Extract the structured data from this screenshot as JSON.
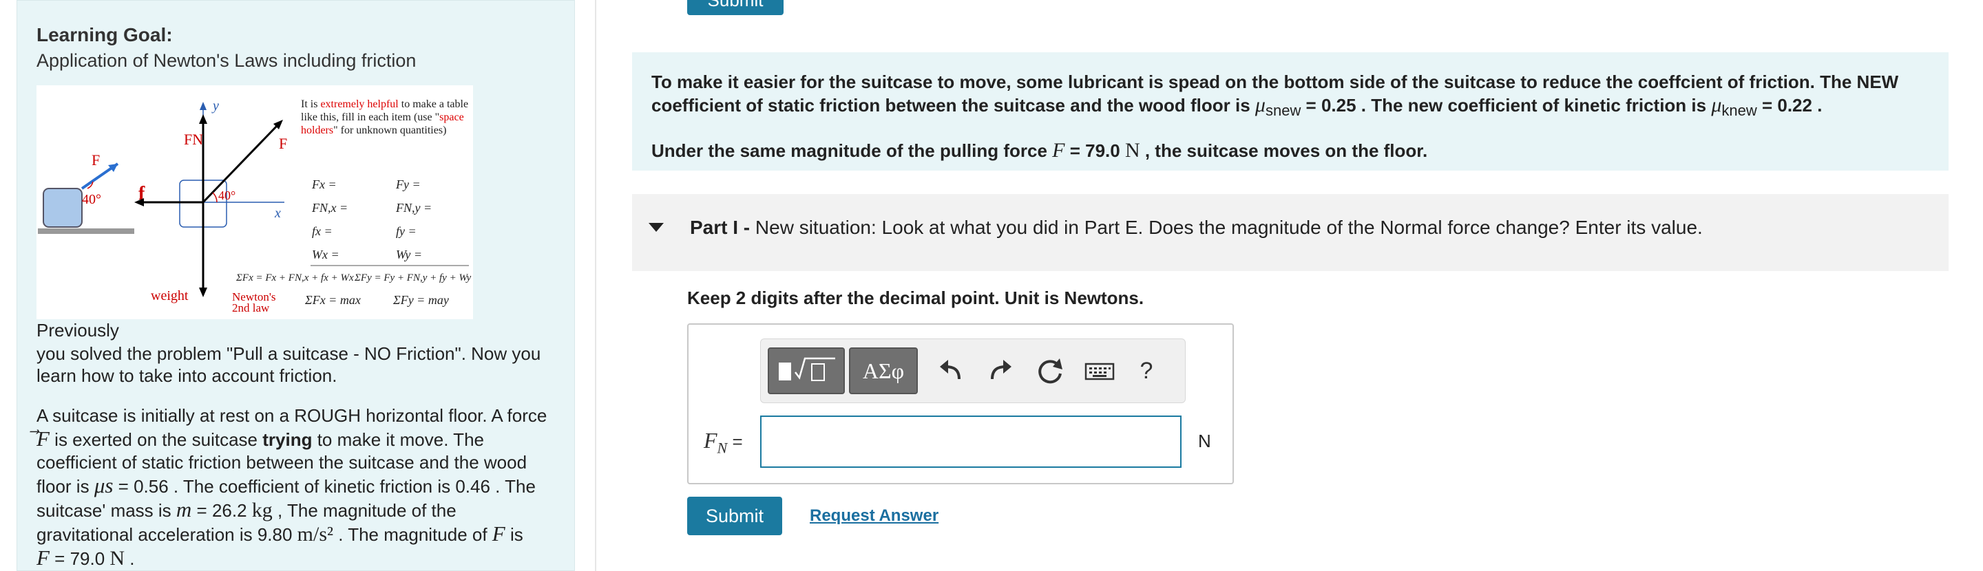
{
  "left": {
    "goal_title": "Learning Goal:",
    "goal_subtitle": "Application of Newton's Laws including friction",
    "figure": {
      "note_prefix": "It is ",
      "note_highlight": "extremely helpful",
      "note_mid": " to make a table like this, fill in each item (use \"",
      "note_highlight2": "space holders",
      "note_suffix": "\" for unknown quantities)",
      "label_F": "F",
      "label_FN": "FN",
      "label_f": "f",
      "label_angle": "40°",
      "label_weight": "weight",
      "label_x": "x",
      "label_y": "y",
      "newtons_law": "Newton's 2nd law",
      "table_left": [
        "Fx =",
        "FN,x =",
        "fx =",
        "Wx ="
      ],
      "table_right": [
        "Fy =",
        "FN,y =",
        "fy =",
        "Wy ="
      ],
      "sum_x": "ΣFx = Fx + FN,x + fx + Wx",
      "sum_y": "ΣFy = Fy + FN,y + fy + Wy",
      "newton_x": "ΣFx = max",
      "newton_y": "ΣFy = may"
    },
    "intro_word": "Previously",
    "intro_rest": "you solved the problem \"Pull a suitcase - NO Friction\". Now you learn how to take into account friction.",
    "problem": {
      "p1": "A suitcase is initially at rest on a ROUGH horizontal floor. A force ",
      "force_sym": "F",
      "p2": " is exerted on the suitcase ",
      "trying": "trying",
      "p3": " to make it move. The coefficient of static friction between the suitcase and the wood floor is ",
      "mu_s": "μs",
      "mu_s_val": " = 0.56 . The coefficient of kinetic friction is 0.46 . The suitcase' mass is ",
      "m_sym": "m",
      "m_val": " = 26.2 ",
      "m_unit": "kg",
      "p4": " , The magnitude of the gravitational acceleration is 9.80 ",
      "g_unit": "m/s²",
      "p5": " . The magnitude of ",
      "p6": " is",
      "F_val_sym": "F",
      "F_val": " = 79.0 ",
      "F_unit": "N",
      "end": " ."
    }
  },
  "top_submit_label": "Submit",
  "info": {
    "line1": "To make it easier for the suitcase to move, some lubricant is spead on the bottom side of the suitcase to reduce the coeffcient of friction. The NEW",
    "line2a": "coefficient of static friction between the suitcase and the wood floor is ",
    "mu_snew": "μ",
    "mu_snew_sub": "snew",
    "line2b": " = 0.25 . The new coefficient of kinetic friction is ",
    "mu_knew": "μ",
    "mu_knew_sub": "knew",
    "line2c": " = 0.22 .",
    "line3a": "Under the same magnitude of the pulling force ",
    "F_sym": "F",
    "line3b": " = 79.0 ",
    "N_unit": "N",
    "line3c": " , the suitcase moves on the floor."
  },
  "part": {
    "label": "Part I -",
    "text": " New situation: Look at what you did in Part E. Does the magnitude of the Normal  force change? Enter its value."
  },
  "instruction": "Keep 2 digits after the decimal point. Unit is Newtons.",
  "answer": {
    "toolbar": {
      "greek_label": "ΑΣφ",
      "help_label": "?"
    },
    "var_symbol": "F",
    "var_sub": "N",
    "equals": " =",
    "value": "",
    "unit": "N"
  },
  "submit_label": "Submit",
  "request_label": "Request Answer"
}
